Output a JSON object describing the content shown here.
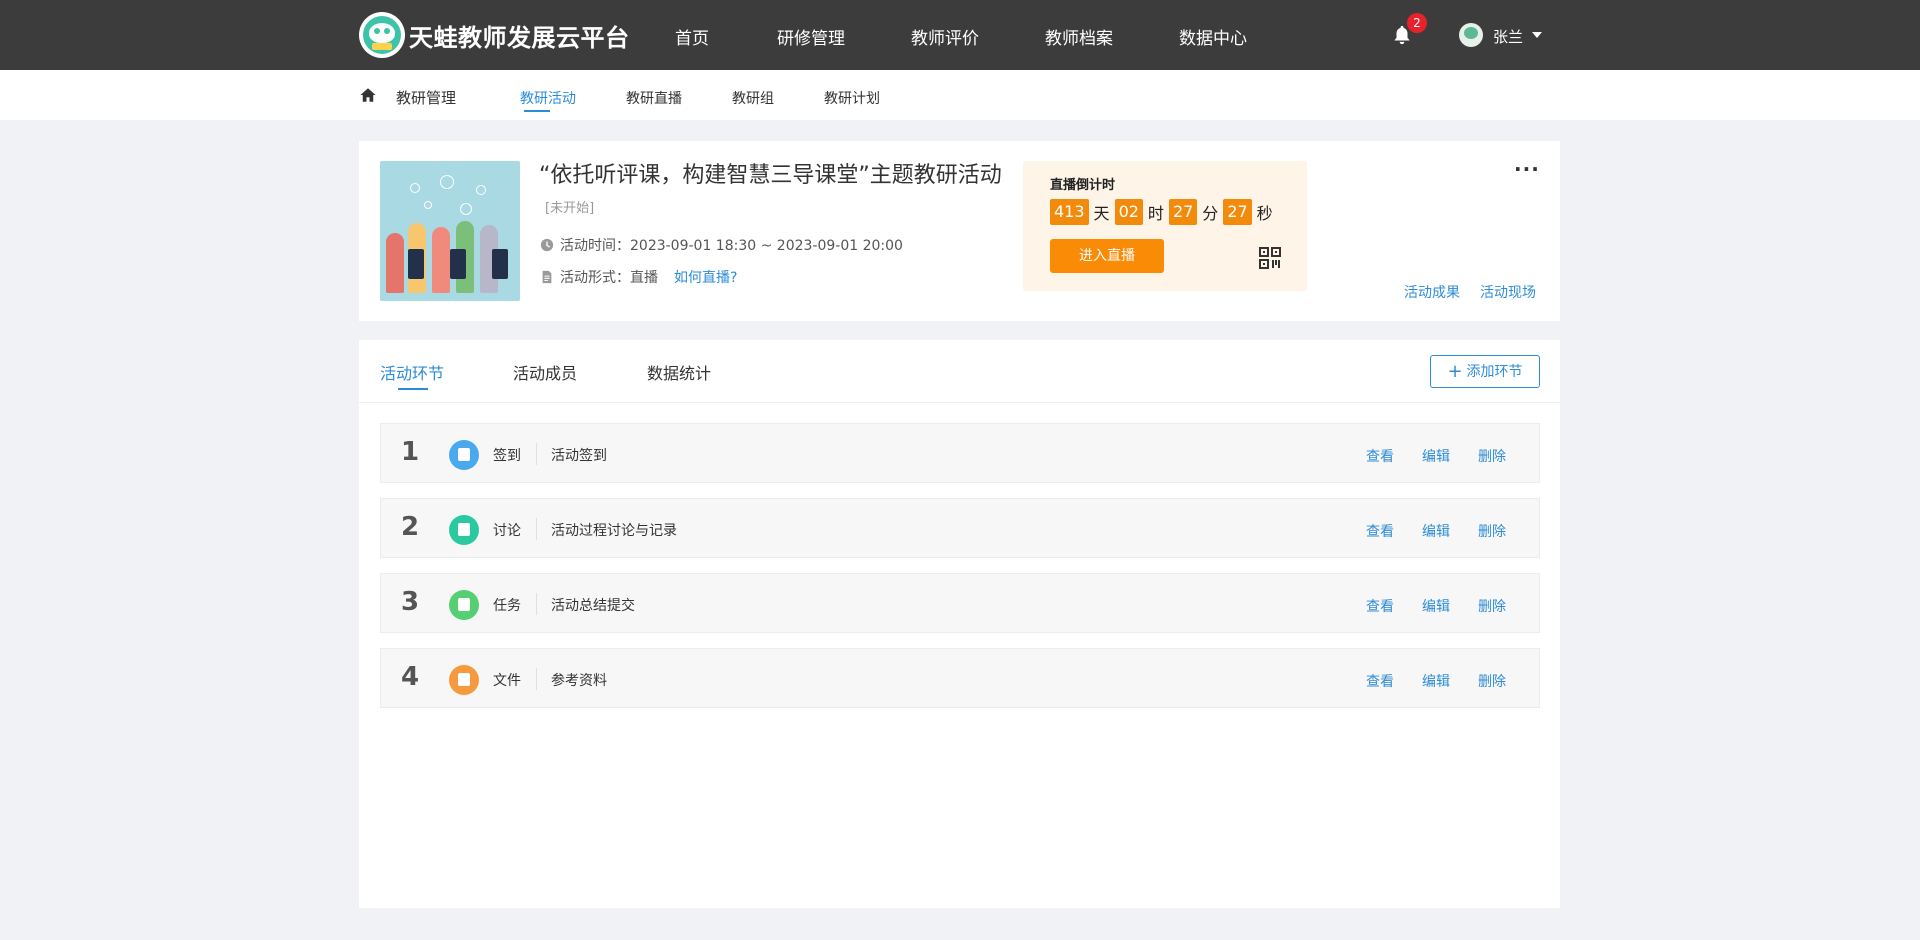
{
  "header": {
    "site_title": "天蛙教师发展云平台",
    "nav": [
      "首页",
      "研修管理",
      "教师评价",
      "教师档案",
      "数据中心"
    ],
    "notification_count": "2",
    "username": "张兰"
  },
  "subnav": {
    "section": "教研管理",
    "tabs": [
      "教研活动",
      "教研直播",
      "教研组",
      "教研计划"
    ],
    "active_tab": "教研活动"
  },
  "activity": {
    "title": "“依托听评课，构建智慧三导课堂”主题教研活动",
    "status": "[未开始]",
    "time_label": "活动时间：2023-09-01 18:30 ~ 2023-09-01 20:00",
    "form_label": "活动形式：直播",
    "how_link": "如何直播?",
    "countdown": {
      "title": "直播倒计时",
      "days": "413",
      "days_unit": "天",
      "hours": "02",
      "hours_unit": "时",
      "minutes": "27",
      "minutes_unit": "分",
      "seconds": "27",
      "seconds_unit": "秒",
      "button": "进入直播"
    },
    "more": "···",
    "links": [
      "活动成果",
      "活动现场"
    ]
  },
  "main": {
    "tabs": [
      "活动环节",
      "活动成员",
      "数据统计"
    ],
    "active_tab": "活动环节",
    "add_button": "添加环节",
    "steps": [
      {
        "num": "1",
        "type": "签到",
        "name": "活动签到",
        "icon": "checkin-icon",
        "color": "#4aa8ee"
      },
      {
        "num": "2",
        "type": "讨论",
        "name": "活动过程讨论与记录",
        "icon": "discussion-icon",
        "color": "#2bc9a0"
      },
      {
        "num": "3",
        "type": "任务",
        "name": "活动总结提交",
        "icon": "task-icon",
        "color": "#56cf72"
      },
      {
        "num": "4",
        "type": "文件",
        "name": "参考资料",
        "icon": "file-icon",
        "color": "#f59a3e"
      }
    ],
    "actions": [
      "查看",
      "编辑",
      "删除"
    ]
  },
  "colors": {
    "accent": "#2d8cd8",
    "header_bg": "#3c3c3c",
    "orange": "#f98b06"
  }
}
